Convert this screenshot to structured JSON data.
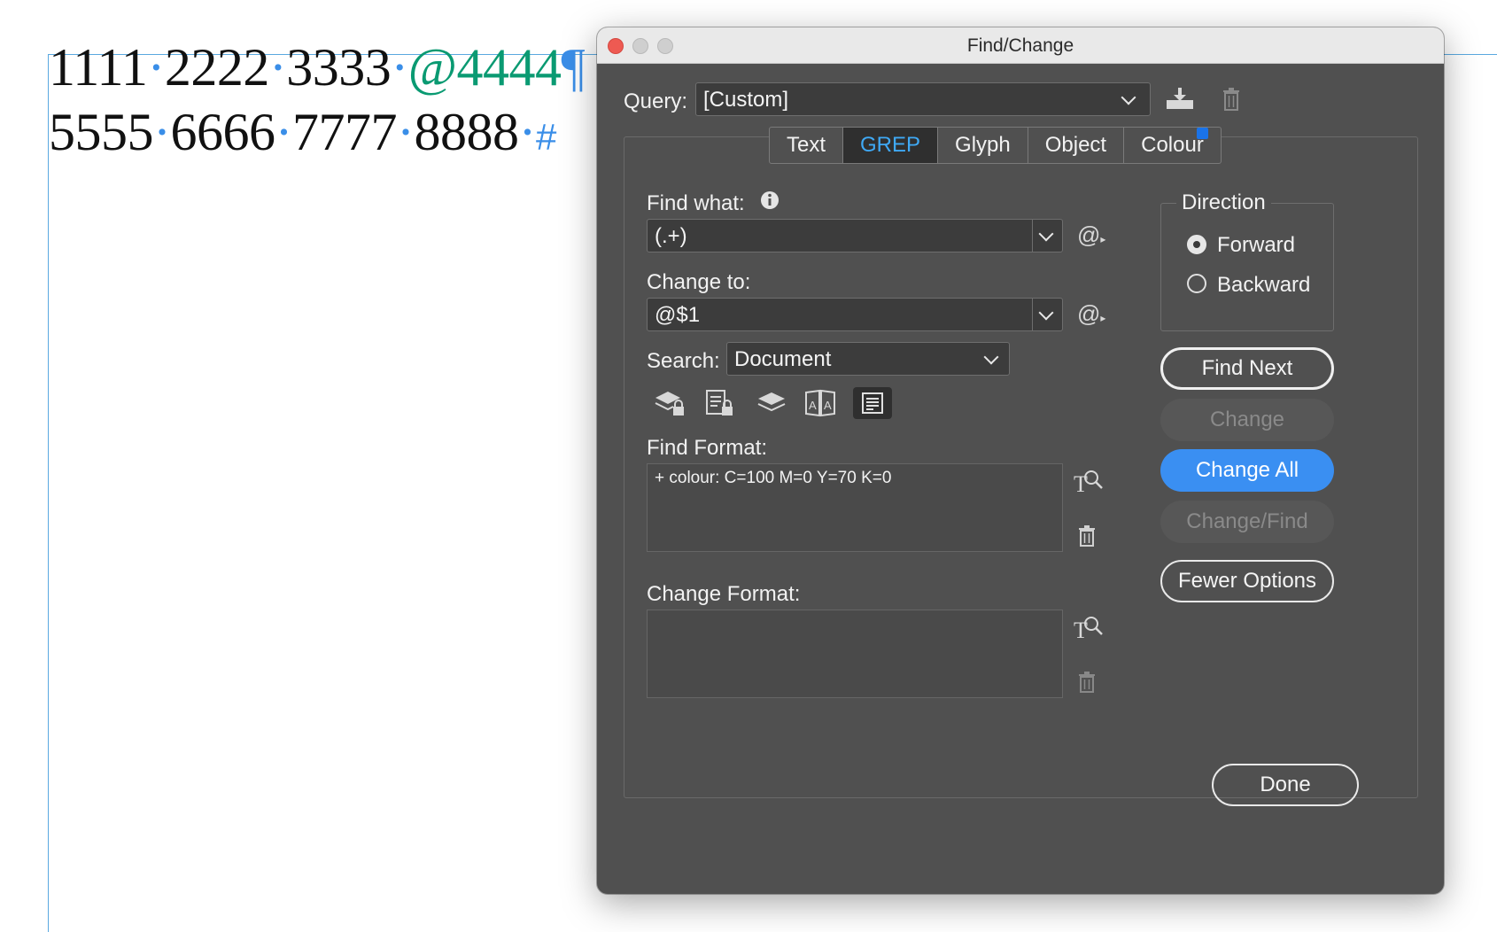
{
  "document": {
    "line1": {
      "a": "1111",
      "b": "2222",
      "c": "3333",
      "d": "@4444",
      "dot": "·",
      "end": "¶"
    },
    "line2": {
      "a": "5555",
      "b": "6666",
      "c": "7777",
      "d": "8888",
      "dot": "·",
      "end": "#"
    }
  },
  "dialog": {
    "title": "Find/Change",
    "query": {
      "label": "Query:",
      "value": "[Custom]"
    },
    "tabs": [
      {
        "label": "Text",
        "active": false
      },
      {
        "label": "GREP",
        "active": true
      },
      {
        "label": "Glyph",
        "active": false
      },
      {
        "label": "Object",
        "active": false
      },
      {
        "label": "Colour",
        "active": false
      }
    ],
    "find_what": {
      "label": "Find what:",
      "value": "(.+)"
    },
    "change_to": {
      "label": "Change to:",
      "value": "@$1"
    },
    "search": {
      "label": "Search:",
      "value": "Document"
    },
    "find_format": {
      "label": "Find Format:",
      "value": "+ colour: C=100 M=0 Y=70 K=0"
    },
    "change_format": {
      "label": "Change Format:",
      "value": ""
    },
    "direction": {
      "label": "Direction",
      "options": [
        {
          "label": "Forward",
          "selected": true
        },
        {
          "label": "Backward",
          "selected": false
        }
      ]
    },
    "buttons": {
      "find_next": "Find Next",
      "change": "Change",
      "change_all": "Change All",
      "change_find": "Change/Find",
      "fewer_options": "Fewer Options",
      "done": "Done"
    },
    "special_char_symbol": "@"
  },
  "colors": {
    "accent": "#3a8ff2",
    "active_tab_text": "#3fa9f5",
    "dialog_bg": "#505050",
    "teal_text": "#0a9a72"
  }
}
